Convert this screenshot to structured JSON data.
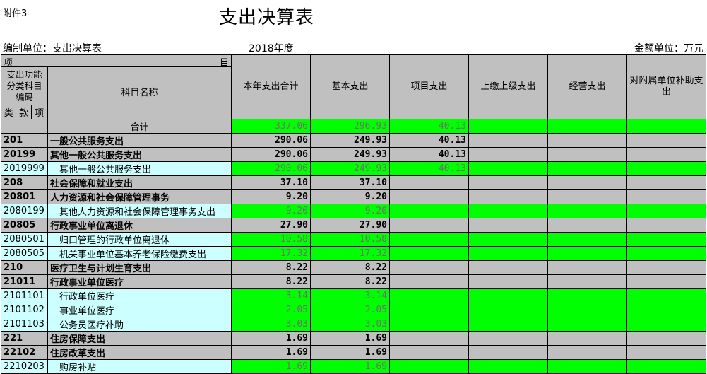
{
  "attachment": "附件3",
  "title": "支出决算表",
  "unit_label": "编制单位：支出决算表",
  "year": "2018年度",
  "amount_unit": "金额单位：万元",
  "header": {
    "xiang": "项",
    "mu": "目",
    "code_col": "支出功能分类科目编码",
    "name_col": "科目名称",
    "lei": "类",
    "kuan": "款",
    "xiang2": "项",
    "columns": [
      "本年支出合计",
      "基本支出",
      "项目支出",
      "上缴上级支出",
      "经营支出",
      "对附属单位补助支出"
    ]
  },
  "rows": [
    {
      "type": "total",
      "code": "",
      "name": "合计",
      "values": [
        "337.06",
        "296.93",
        "40.13",
        "",
        "",
        ""
      ]
    },
    {
      "type": "bold",
      "code": "201",
      "name": "一般公共服务支出",
      "values": [
        "290.06",
        "249.93",
        "40.13",
        "",
        "",
        ""
      ]
    },
    {
      "type": "bold",
      "code": "20199",
      "name": "其他一般公共服务支出",
      "values": [
        "290.06",
        "249.93",
        "40.13",
        "",
        "",
        ""
      ]
    },
    {
      "type": "leaf",
      "code": "2019999",
      "name": "其他一般公共服务支出",
      "values": [
        "290.06",
        "249.93",
        "40.13",
        "",
        "",
        ""
      ]
    },
    {
      "type": "bold",
      "code": "208",
      "name": "社会保障和就业支出",
      "values": [
        "37.10",
        "37.10",
        "",
        "",
        "",
        ""
      ]
    },
    {
      "type": "bold",
      "code": "20801",
      "name": "人力资源和社会保障管理事务",
      "values": [
        "9.20",
        "9.20",
        "",
        "",
        "",
        ""
      ]
    },
    {
      "type": "leaf",
      "code": "2080199",
      "name": "其他人力资源和社会保障管理事务支出",
      "values": [
        "9.20",
        "9.20",
        "",
        "",
        "",
        ""
      ]
    },
    {
      "type": "bold",
      "code": "20805",
      "name": "行政事业单位离退休",
      "values": [
        "27.90",
        "27.90",
        "",
        "",
        "",
        ""
      ]
    },
    {
      "type": "leaf",
      "code": "2080501",
      "name": "归口管理的行政单位离退休",
      "values": [
        "10.58",
        "10.58",
        "",
        "",
        "",
        ""
      ]
    },
    {
      "type": "leaf",
      "code": "2080505",
      "name": "机关事业单位基本养老保险缴费支出",
      "values": [
        "17.32",
        "17.32",
        "",
        "",
        "",
        ""
      ]
    },
    {
      "type": "bold",
      "code": "210",
      "name": "医疗卫生与计划生育支出",
      "values": [
        "8.22",
        "8.22",
        "",
        "",
        "",
        ""
      ]
    },
    {
      "type": "bold",
      "code": "21011",
      "name": "行政事业单位医疗",
      "values": [
        "8.22",
        "8.22",
        "",
        "",
        "",
        ""
      ]
    },
    {
      "type": "leaf",
      "code": "2101101",
      "name": "行政单位医疗",
      "values": [
        "3.14",
        "3.14",
        "",
        "",
        "",
        ""
      ]
    },
    {
      "type": "leaf",
      "code": "2101102",
      "name": "事业单位医疗",
      "values": [
        "2.05",
        "2.05",
        "",
        "",
        "",
        ""
      ]
    },
    {
      "type": "leaf",
      "code": "2101103",
      "name": "公务员医疗补助",
      "values": [
        "3.03",
        "3.03",
        "",
        "",
        "",
        ""
      ]
    },
    {
      "type": "bold",
      "code": "221",
      "name": "住房保障支出",
      "values": [
        "1.69",
        "1.69",
        "",
        "",
        "",
        ""
      ]
    },
    {
      "type": "bold",
      "code": "22102",
      "name": "住房改革支出",
      "values": [
        "1.69",
        "1.69",
        "",
        "",
        "",
        ""
      ]
    },
    {
      "type": "leaf",
      "code": "2210203",
      "name": "购房补贴",
      "values": [
        "1.69",
        "1.69",
        "",
        "",
        "",
        ""
      ]
    }
  ]
}
